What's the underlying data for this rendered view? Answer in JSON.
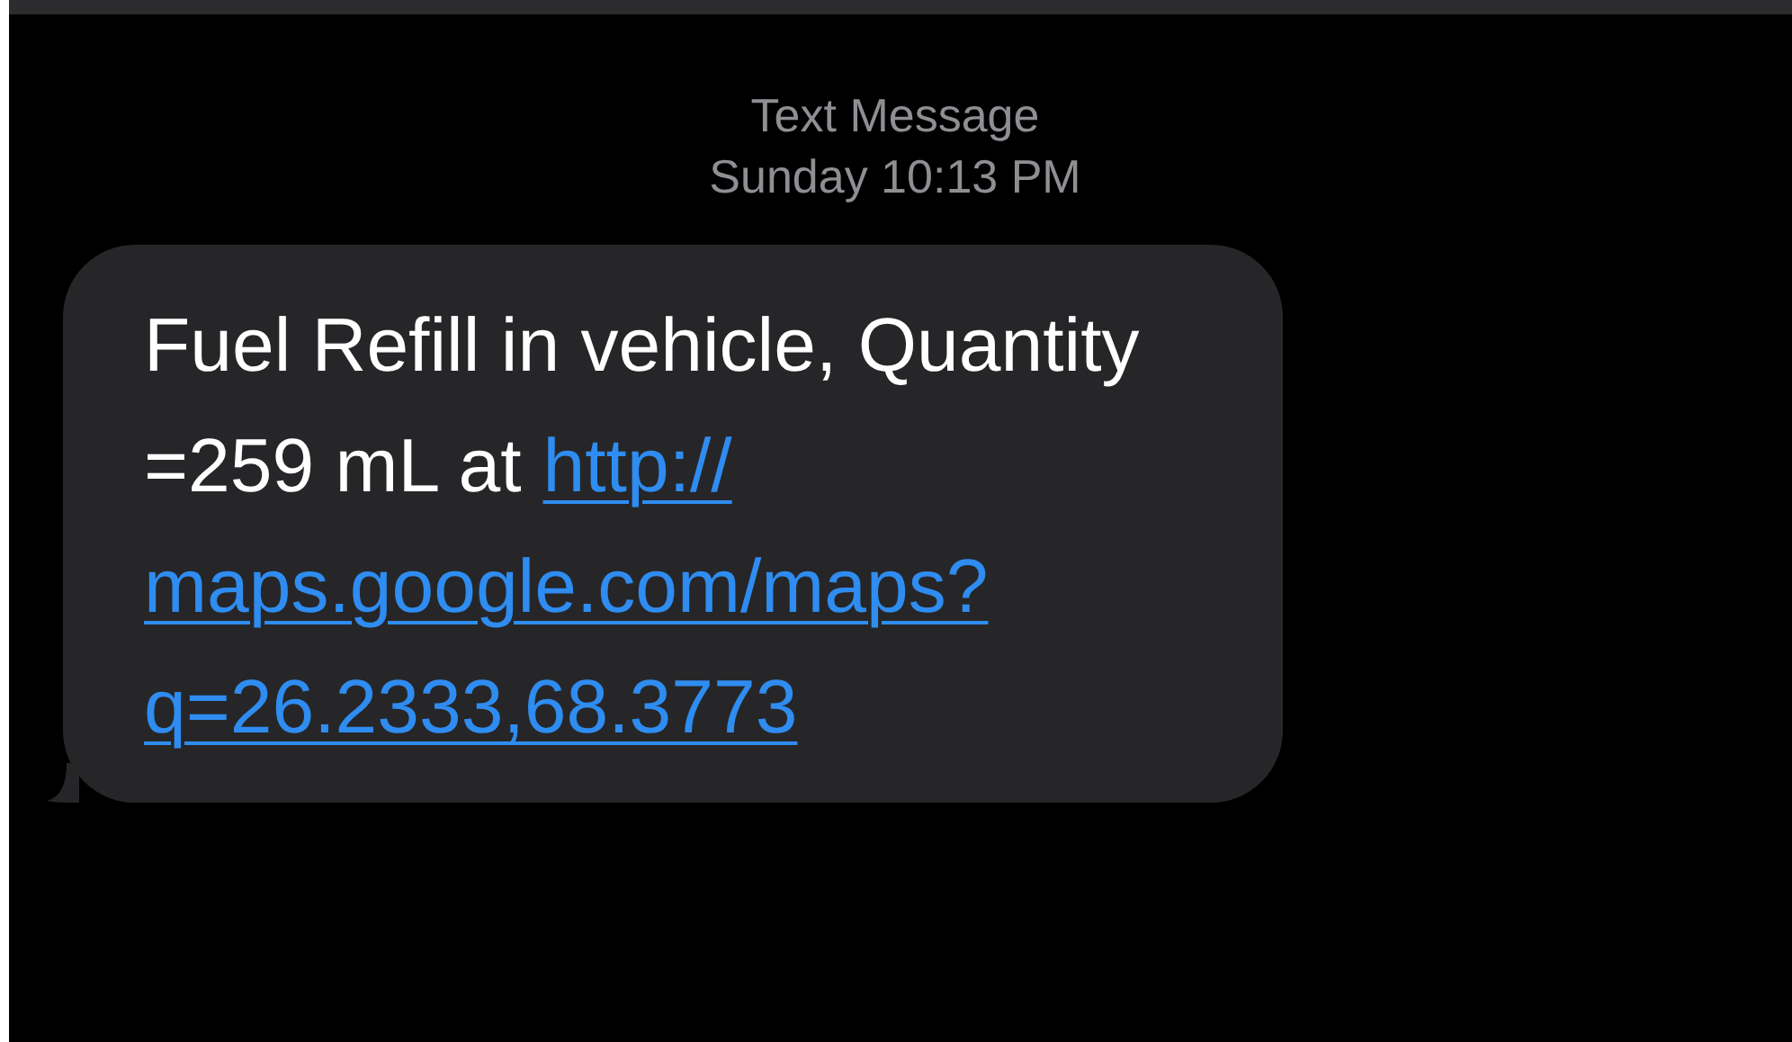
{
  "header": {
    "title": "Text Message",
    "timestamp": "Sunday 10:13 PM"
  },
  "messages": [
    {
      "kind": "received",
      "lines": [
        [
          {
            "kind": "text",
            "text": "Fuel Refill in vehicle, Quantity"
          }
        ],
        [
          {
            "kind": "text",
            "text": "=259 mL at"
          },
          {
            "kind": "link",
            "text": "http://"
          }
        ],
        [
          {
            "kind": "link",
            "text": "maps.google.com/maps?"
          }
        ],
        [
          {
            "kind": "link",
            "text": "q=26.2333,68.3773"
          }
        ]
      ]
    }
  ]
}
